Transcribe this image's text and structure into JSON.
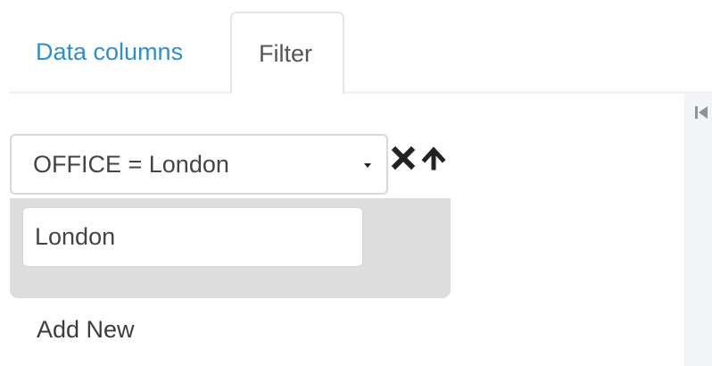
{
  "tabs": {
    "data_columns_label": "Data columns",
    "filter_label": "Filter",
    "active": "Filter"
  },
  "filter": {
    "selected_condition": "OFFICE = London",
    "value": "London",
    "value_placeholder": "",
    "add_new_label": "Add New"
  },
  "icons": {
    "caret": "caret-down-icon",
    "remove": "close-icon",
    "move_up": "arrow-up-icon",
    "collapse": "collapse-left-icon"
  },
  "colors": {
    "link_blue": "#2d8ed1",
    "panel_gray": "#dddddd",
    "side_rail": "#f2f4f7",
    "border": "#d5d9de"
  }
}
